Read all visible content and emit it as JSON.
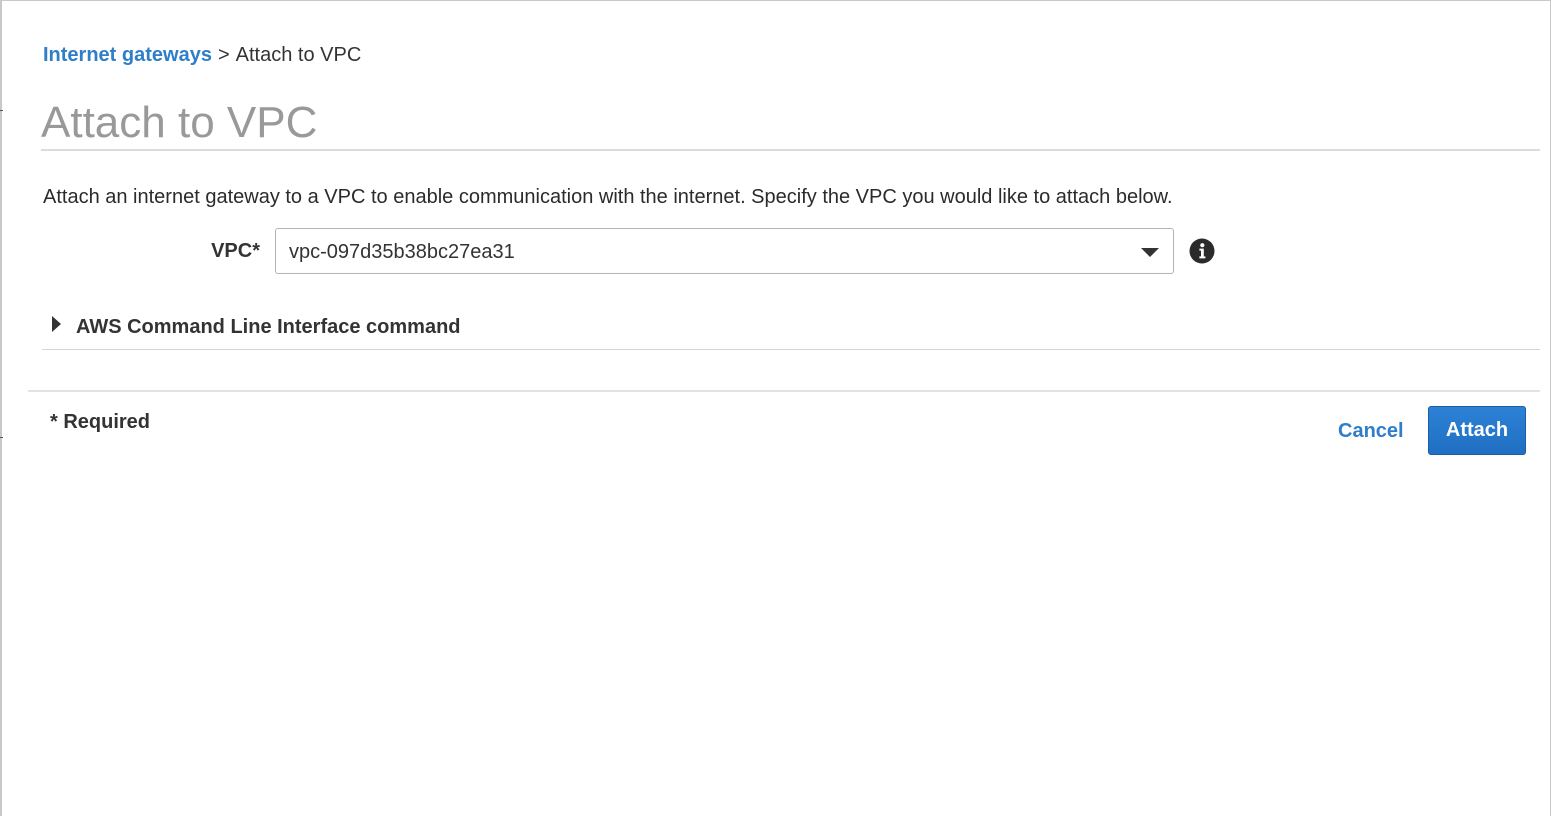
{
  "breadcrumb": {
    "parent_label": "Internet gateways",
    "separator": ">",
    "current_label": "Attach to VPC"
  },
  "page": {
    "title": "Attach to VPC",
    "description": "Attach an internet gateway to a VPC to enable communication with the internet. Specify the VPC you would like to attach below."
  },
  "form": {
    "vpc_label": "VPC*",
    "vpc_value": "vpc-097d35b38bc27ea31",
    "info_icon": "info-circle-icon"
  },
  "cli": {
    "label": "AWS Command Line Interface command",
    "expanded": false,
    "icon": "caret-right-icon"
  },
  "footer": {
    "required_note": "* Required",
    "cancel_label": "Cancel",
    "attach_label": "Attach"
  },
  "colors": {
    "link": "#2f7ec9",
    "primary_button": "#1f6fc2",
    "title": "#999999"
  }
}
